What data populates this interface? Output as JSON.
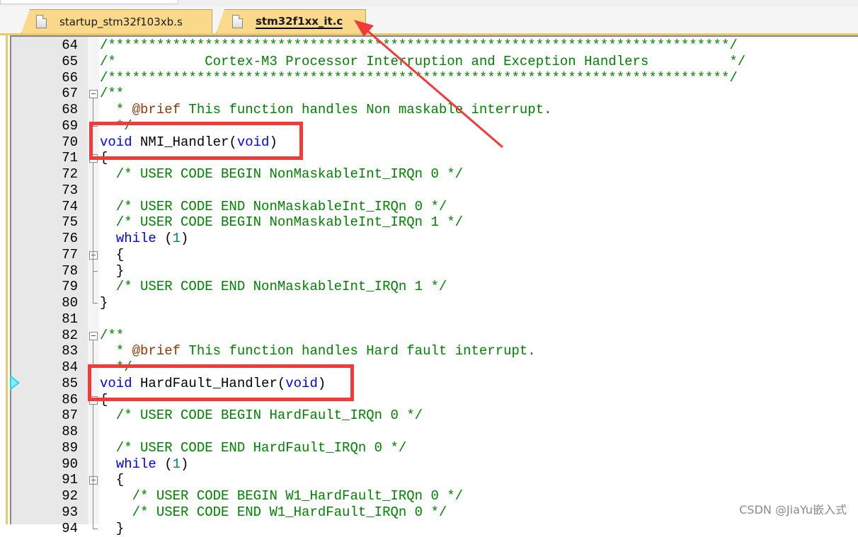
{
  "tabs": [
    {
      "label": "startup_stm32f103xb.s",
      "active": false,
      "icon": "file-icon"
    },
    {
      "label": "stm32f1xx_it.c",
      "active": true,
      "icon": "file-icon"
    }
  ],
  "colors": {
    "comment": "#008000",
    "keyword": "#0000ff",
    "number": "#008080",
    "doctag": "#8b3a0f",
    "highlight": "#f33a3a",
    "tab_bg": "#fbd98a"
  },
  "lines": [
    {
      "n": "64",
      "c": "/*****************************************************************************/"
    },
    {
      "n": "65",
      "c": "/*           Cortex-M3 Processor Interruption and Exception Handlers          */"
    },
    {
      "n": "66",
      "c": "/*****************************************************************************/"
    },
    {
      "n": "67",
      "c": "/**"
    },
    {
      "n": "68",
      "c": "  * @brief This function handles Non maskable interrupt."
    },
    {
      "n": "69",
      "c": "  */"
    },
    {
      "n": "70",
      "c": "void NMI_Handler(void)"
    },
    {
      "n": "71",
      "c": "{"
    },
    {
      "n": "72",
      "c": "  /* USER CODE BEGIN NonMaskableInt_IRQn 0 */"
    },
    {
      "n": "73",
      "c": ""
    },
    {
      "n": "74",
      "c": "  /* USER CODE END NonMaskableInt_IRQn 0 */"
    },
    {
      "n": "75",
      "c": "  /* USER CODE BEGIN NonMaskableInt_IRQn 1 */"
    },
    {
      "n": "76",
      "c": "  while (1)"
    },
    {
      "n": "77",
      "c": "  {"
    },
    {
      "n": "78",
      "c": "  }"
    },
    {
      "n": "79",
      "c": "  /* USER CODE END NonMaskableInt_IRQn 1 */"
    },
    {
      "n": "80",
      "c": "}"
    },
    {
      "n": "81",
      "c": ""
    },
    {
      "n": "82",
      "c": "/**"
    },
    {
      "n": "83",
      "c": "  * @brief This function handles Hard fault interrupt."
    },
    {
      "n": "84",
      "c": "  */"
    },
    {
      "n": "85",
      "c": "void HardFault_Handler(void)"
    },
    {
      "n": "86",
      "c": "{"
    },
    {
      "n": "87",
      "c": "  /* USER CODE BEGIN HardFault_IRQn 0 */"
    },
    {
      "n": "88",
      "c": ""
    },
    {
      "n": "89",
      "c": "  /* USER CODE END HardFault_IRQn 0 */"
    },
    {
      "n": "90",
      "c": "  while (1)"
    },
    {
      "n": "91",
      "c": "  {"
    },
    {
      "n": "92",
      "c": "    /* USER CODE BEGIN W1_HardFault_IRQn 0 */"
    },
    {
      "n": "93",
      "c": "    /* USER CODE END W1_HardFault_IRQn 0 */"
    },
    {
      "n": "94",
      "c": "  }"
    }
  ],
  "annotations": {
    "highlight_boxes": [
      "NMI_Handler",
      "HardFault_Handler"
    ],
    "arrow_target": "stm32f1xx_it.c tab",
    "current_line_marker": "85"
  },
  "watermark": "CSDN @JiaYu嵌入式"
}
